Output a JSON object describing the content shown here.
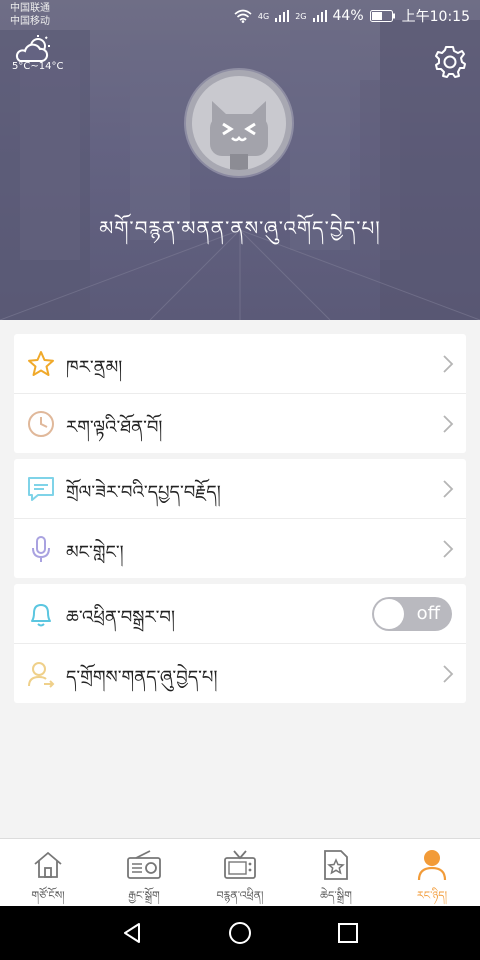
{
  "status": {
    "carrier1": "中国联通",
    "carrier2": "中国移动",
    "net1": "4G",
    "net2": "2G",
    "battery": "44%",
    "time": "上午10:15"
  },
  "weather": {
    "icon": "partly-cloudy-icon",
    "temp": "5°C~14°C"
  },
  "profile": {
    "login_text": "མགོ་བརྙན་མནན་ནས་ཞུ་འགོད་བྱེད་པ།"
  },
  "menu_groups": [
    [
      {
        "name": "favorites",
        "icon": "star-icon",
        "label": "ཁར་ནྲམ།"
      },
      {
        "name": "history",
        "icon": "clock-icon",
        "label": "རག་ལྟའི་ཐོན་བོ།"
      }
    ],
    [
      {
        "name": "feedback",
        "icon": "message-icon",
        "label": "གྲོལ་ཟེར་བའི་དཔྱད་བརྗོད།"
      },
      {
        "name": "voice",
        "icon": "microphone-icon",
        "label": "མང་གླེང་།"
      }
    ],
    [
      {
        "name": "notification",
        "icon": "bell-icon",
        "label": "ཆ་འཕྲིན་བསྒྲར་བ།",
        "toggle": "off"
      },
      {
        "name": "account",
        "icon": "user-switch-icon",
        "label": "ད་གྲོགས་གནད་ཞུ་བྱེད་པ།"
      }
    ]
  ],
  "tabbar": [
    {
      "name": "home",
      "icon": "home-icon",
      "label": "གཙོ་ངོས།"
    },
    {
      "name": "radio",
      "icon": "radio-icon",
      "label": "རྒྱང་སྒྲོག"
    },
    {
      "name": "tv",
      "icon": "tv-icon",
      "label": "བརྙན་འཕྲིན།"
    },
    {
      "name": "favorites",
      "icon": "document-star-icon",
      "label": "ཆེད་སྒྲིག"
    },
    {
      "name": "profile",
      "icon": "person-icon",
      "label": "རང་ཉིད།",
      "active": true
    }
  ],
  "colors": {
    "accent": "#f29b38",
    "header": "#646382",
    "toggle_off": "#b9b9bf"
  }
}
